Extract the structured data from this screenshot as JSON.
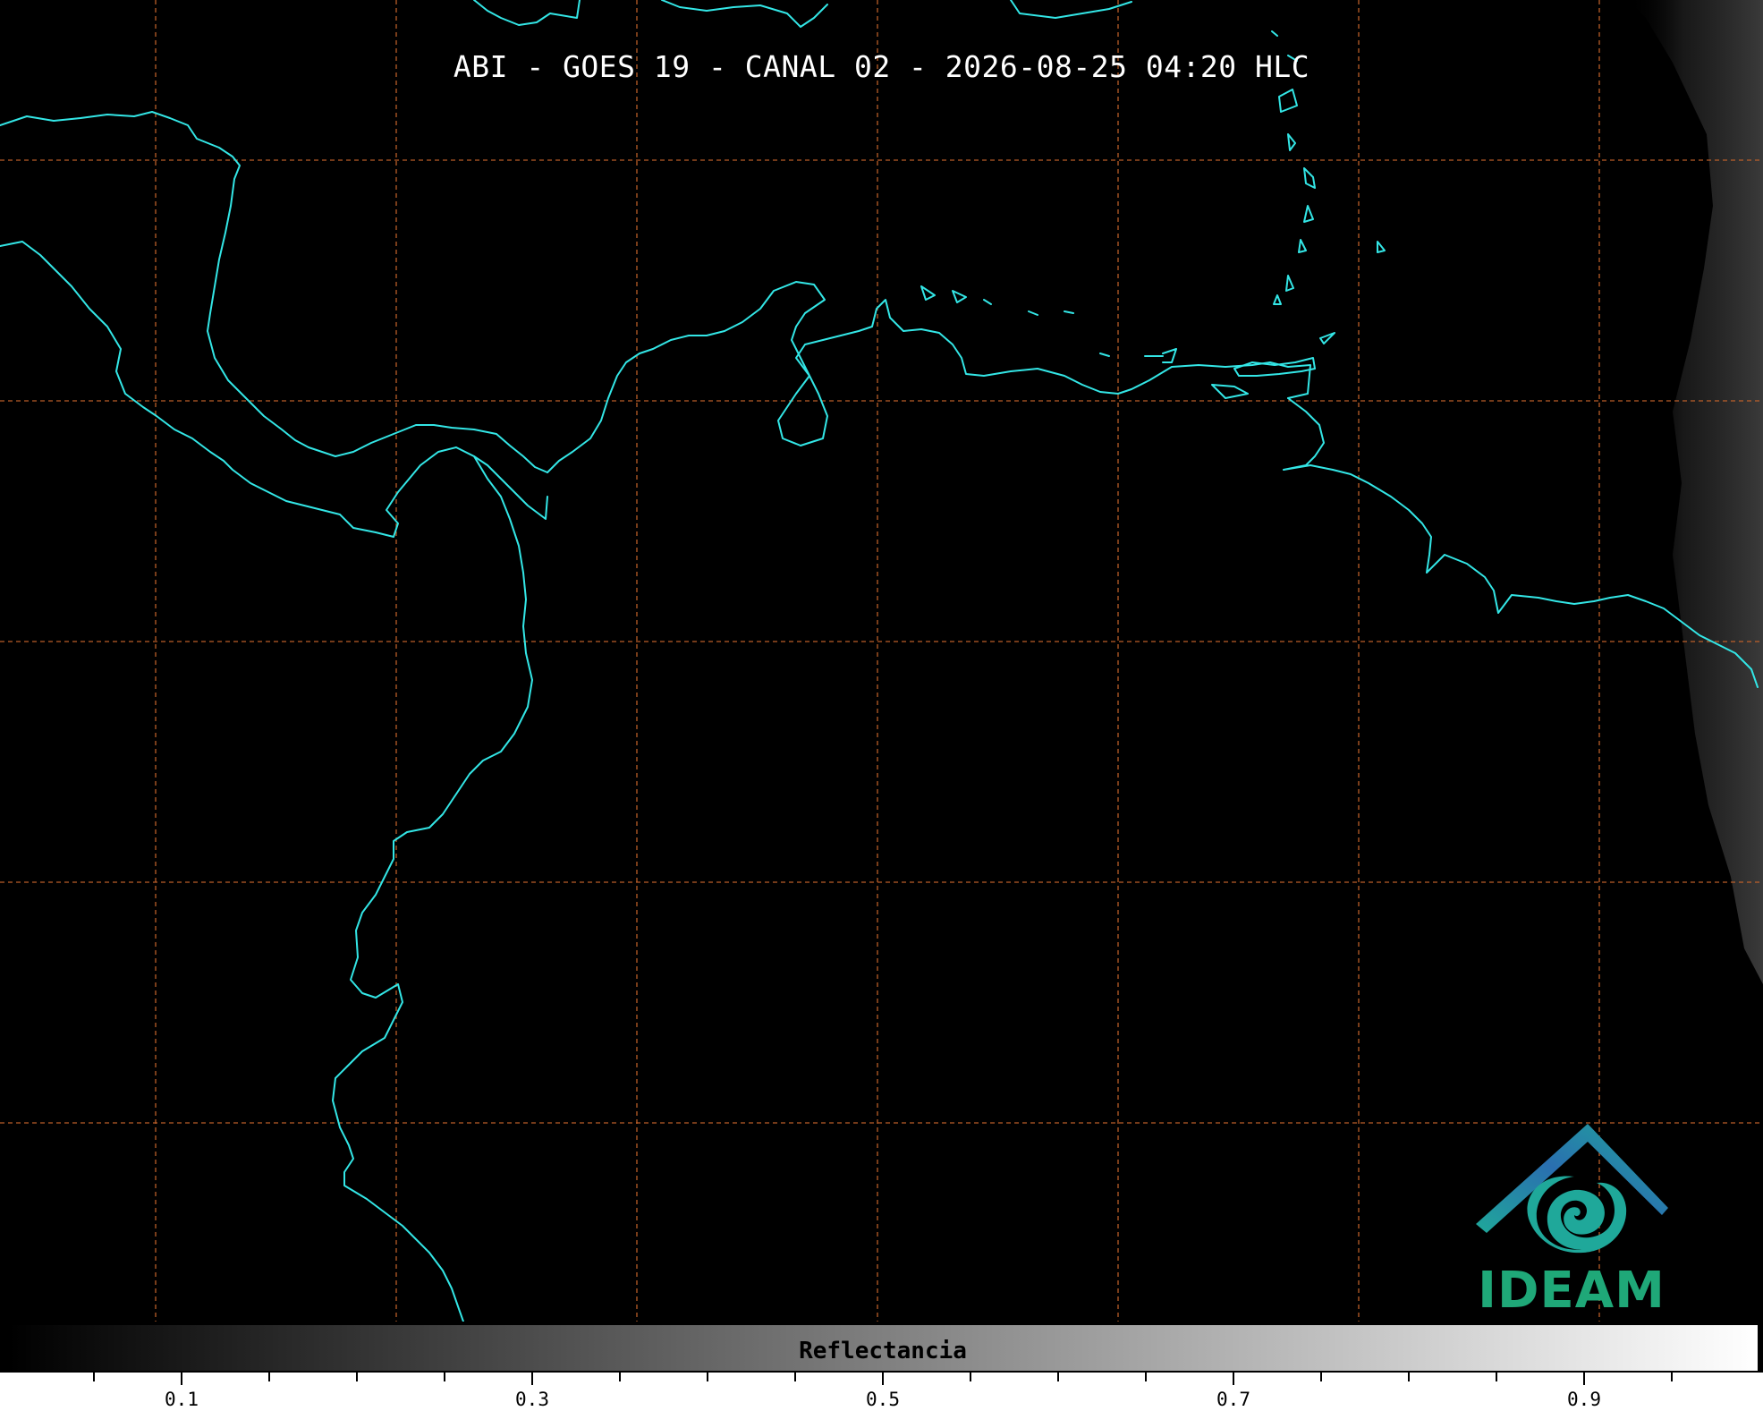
{
  "title": "ABI - GOES 19 - CANAL 02 - 2026-08-25 04:20 HLC",
  "colorbar": {
    "label": "Reflectancia",
    "min": 0.0,
    "max": 1.0,
    "tick_labels": [
      {
        "value": 0.1,
        "text": "0.1"
      },
      {
        "value": 0.3,
        "text": "0.3"
      },
      {
        "value": 0.5,
        "text": "0.5"
      },
      {
        "value": 0.7,
        "text": "0.7"
      },
      {
        "value": 0.9,
        "text": "0.9"
      }
    ],
    "minor_tick_step": 0.05,
    "colors": [
      "#000000",
      "#ffffff"
    ]
  },
  "logo": {
    "text": "IDEAM",
    "colors": {
      "roof": "#2a6fb0",
      "swirl": "#1fa89a",
      "text": "#1fa878"
    }
  },
  "map": {
    "background": "#000000",
    "coastline_color": "#33e6e6",
    "graticule_color": "#c4632a",
    "graticule_style": "dashed"
  }
}
